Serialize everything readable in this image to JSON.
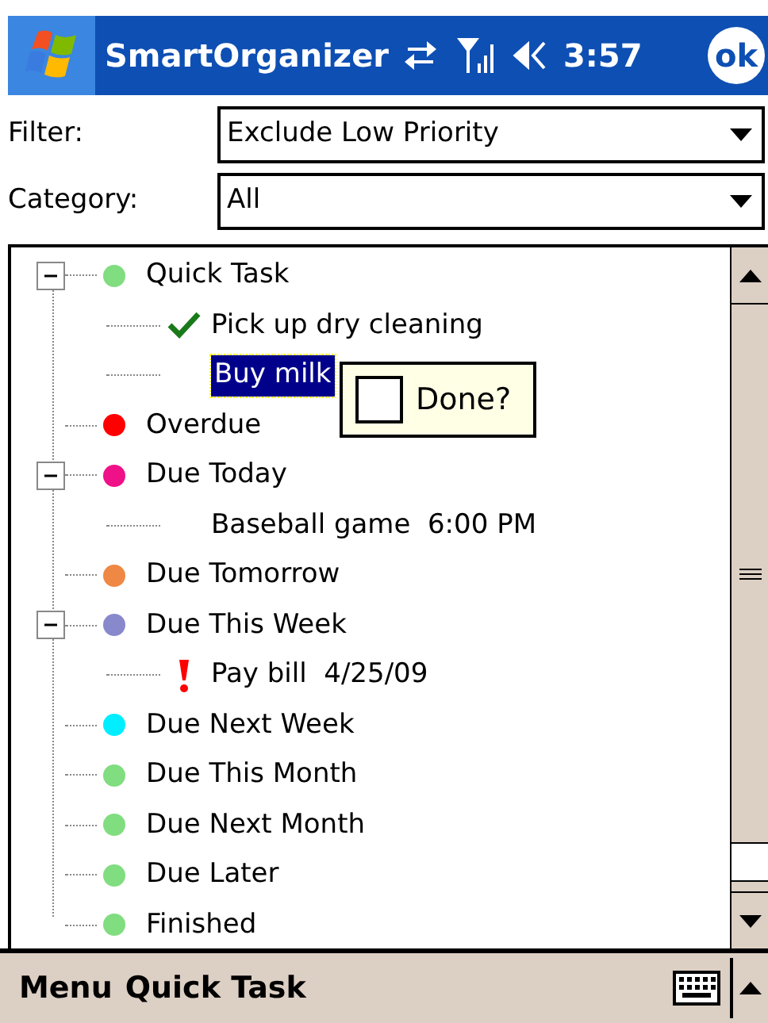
{
  "title_bar": {
    "title": "SmartOrganizer",
    "time": "3:57",
    "ok": "ok"
  },
  "filters": [
    {
      "label": "Filter:",
      "value": "Exclude Low Priority"
    },
    {
      "label": "Category:",
      "value": "All"
    }
  ],
  "tree": [
    {
      "label": "Quick Task",
      "color": "#80dd80",
      "expanded": true,
      "children": [
        {
          "label": "Pick up dry cleaning",
          "kind": "done",
          "selected": false
        },
        {
          "label": "Buy milk",
          "kind": "plain",
          "selected": true
        }
      ]
    },
    {
      "label": "Overdue",
      "color": "#ff0000"
    },
    {
      "label": "Due Today",
      "color": "#ee1188",
      "expanded": true,
      "children": [
        {
          "label": "Baseball game  6:00 PM",
          "kind": "plain",
          "selected": false
        }
      ]
    },
    {
      "label": "Due Tomorrow",
      "color": "#ee8844"
    },
    {
      "label": "Due This Week",
      "color": "#8888cc",
      "expanded": true,
      "children": [
        {
          "label": "Pay bill  4/25/09",
          "kind": "priority",
          "selected": false
        }
      ]
    },
    {
      "label": "Due Next Week",
      "color": "#00eeff"
    },
    {
      "label": "Due This Month",
      "color": "#80dd80"
    },
    {
      "label": "Due Next Month",
      "color": "#80dd80"
    },
    {
      "label": "Due Later",
      "color": "#80dd80"
    },
    {
      "label": "Finished",
      "color": "#80dd80"
    }
  ],
  "popup": {
    "label": "Done?",
    "checked": false
  },
  "menu_bar": {
    "left": "Menu",
    "right": "Quick Task"
  }
}
